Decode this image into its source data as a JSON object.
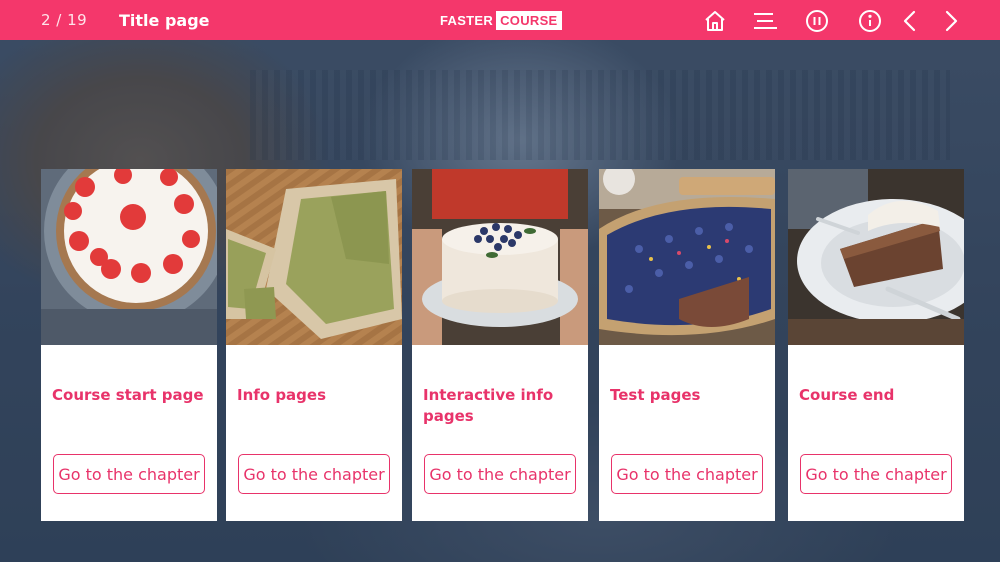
{
  "header": {
    "page_counter": "2 / 19",
    "page_title": "Title page",
    "logo_part1": "FASTER",
    "logo_part2": "COURSE"
  },
  "toolbar": {
    "icons": [
      "home-icon",
      "menu-icon",
      "pause-icon",
      "info-icon",
      "chevron-left-icon",
      "chevron-right-icon"
    ]
  },
  "cards": [
    {
      "title": "Course start page",
      "button": "Go to the chapter",
      "image": "strawberry-cake"
    },
    {
      "title": "Info pages",
      "button": "Go to the chapter",
      "image": "matcha-cake"
    },
    {
      "title": "Interactive info pages",
      "button": "Go to the chapter",
      "image": "blueberry-cake"
    },
    {
      "title": "Test pages",
      "button": "Go to the chapter",
      "image": "blueberry-tart"
    },
    {
      "title": "Course end",
      "button": "Go to the chapter",
      "image": "carrot-cake-slice"
    }
  ],
  "colors": {
    "accent": "#f4376b",
    "card_text": "#e8336a"
  }
}
